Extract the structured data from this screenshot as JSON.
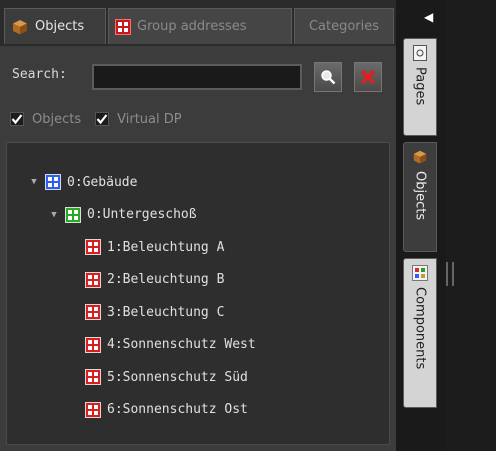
{
  "tabs": [
    {
      "label": "Objects",
      "icon": "cube-icon",
      "active": true
    },
    {
      "label": "Group addresses",
      "icon": "group-address-icon",
      "active": false
    },
    {
      "label": "Categories",
      "active": false
    }
  ],
  "search": {
    "label": "Search:",
    "value": "",
    "placeholder": ""
  },
  "filters": [
    {
      "label": "Objects",
      "checked": true
    },
    {
      "label": "Virtual DP",
      "checked": true
    }
  ],
  "tree": [
    {
      "label": "0:Gebäude",
      "level": 0,
      "expanded": true,
      "icon_color": "#2f5ff0"
    },
    {
      "label": "0:Untergeschoß",
      "level": 1,
      "expanded": true,
      "icon_color": "#2aa82a"
    },
    {
      "label": "1:Beleuchtung A",
      "level": 2,
      "icon_color": "#d42020"
    },
    {
      "label": "2:Beleuchtung B",
      "level": 2,
      "icon_color": "#d42020"
    },
    {
      "label": "3:Beleuchtung C",
      "level": 2,
      "icon_color": "#d42020"
    },
    {
      "label": "4:Sonnenschutz West",
      "level": 2,
      "icon_color": "#d42020"
    },
    {
      "label": "5:Sonnenschutz Süd",
      "level": 2,
      "icon_color": "#d42020"
    },
    {
      "label": "6:Sonnenschutz Ost",
      "level": 2,
      "icon_color": "#d42020"
    }
  ],
  "side_tabs": [
    {
      "label": "Pages",
      "icon": "page-icon"
    },
    {
      "label": "Objects",
      "icon": "cube-icon"
    },
    {
      "label": "Components",
      "icon": "components-icon"
    }
  ]
}
